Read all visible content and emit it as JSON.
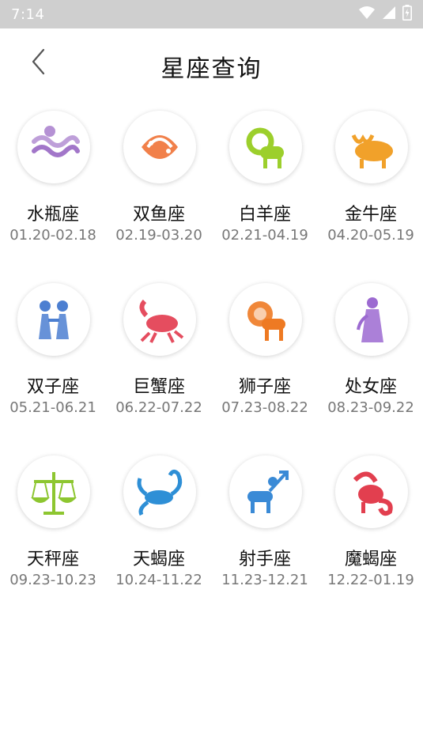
{
  "status_bar": {
    "time": "7:14",
    "icons": [
      "wifi-icon",
      "cell-signal-icon",
      "battery-icon"
    ]
  },
  "header": {
    "title": "星座查询",
    "back_icon": "chevron-left-icon"
  },
  "signs": [
    {
      "name": "水瓶座",
      "dates": "01.20-02.18",
      "icon": "aquarius-icon",
      "color": "#a276c9"
    },
    {
      "name": "双鱼座",
      "dates": "02.19-03.20",
      "icon": "pisces-icon",
      "color": "#ef6a2a"
    },
    {
      "name": "白羊座",
      "dates": "02.21-04.19",
      "icon": "aries-icon",
      "color": "#9ccf2c"
    },
    {
      "name": "金牛座",
      "dates": "04.20-05.19",
      "icon": "taurus-icon",
      "color": "#f1a12a"
    },
    {
      "name": "双子座",
      "dates": "05.21-06.21",
      "icon": "gemini-icon",
      "color": "#4c7fd1"
    },
    {
      "name": "巨蟹座",
      "dates": "06.22-07.22",
      "icon": "cancer-icon",
      "color": "#e54d5f"
    },
    {
      "name": "狮子座",
      "dates": "07.23-08.22",
      "icon": "leo-icon",
      "color": "#ee7a23"
    },
    {
      "name": "处女座",
      "dates": "08.23-09.22",
      "icon": "virgo-icon",
      "color": "#9c6ad1"
    },
    {
      "name": "天秤座",
      "dates": "09.23-10.23",
      "icon": "libra-icon",
      "color": "#8dc630"
    },
    {
      "name": "天蝎座",
      "dates": "10.24-11.22",
      "icon": "scorpio-icon",
      "color": "#2e8fd6"
    },
    {
      "name": "射手座",
      "dates": "11.23-12.21",
      "icon": "sagittarius-icon",
      "color": "#3a8ad6"
    },
    {
      "name": "魔蝎座",
      "dates": "12.22-01.19",
      "icon": "capricorn-icon",
      "color": "#e23f4f"
    }
  ]
}
